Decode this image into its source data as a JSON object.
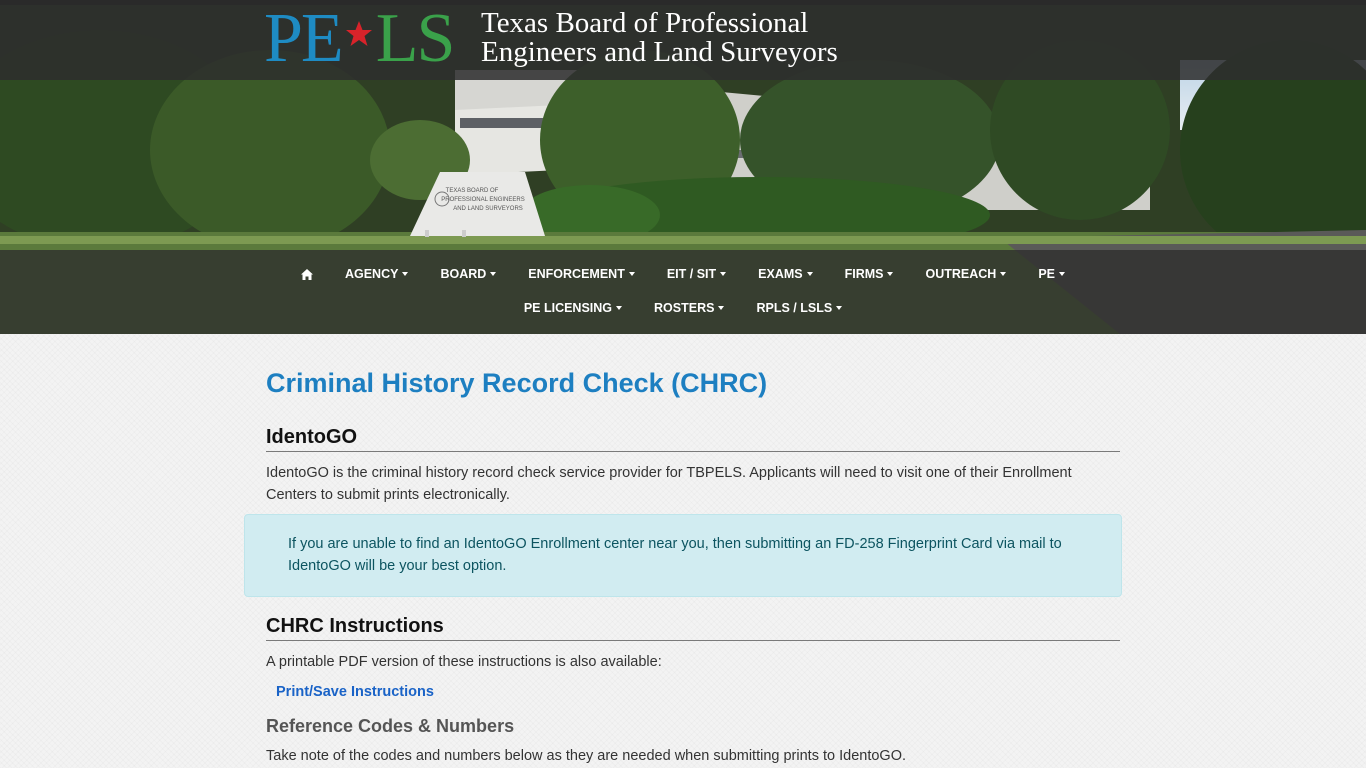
{
  "header": {
    "logo_left": "PE",
    "logo_right": "LS",
    "agency_line1": "Texas Board of Professional",
    "agency_line2": "Engineers and Land Surveyors",
    "sign_line1": "TEXAS BOARD OF",
    "sign_line2": "PROFESSIONAL ENGINEERS",
    "sign_line3": "AND LAND SURVEYORS"
  },
  "nav": {
    "row1": [
      "AGENCY",
      "BOARD",
      "ENFORCEMENT",
      "EIT / SIT",
      "EXAMS",
      "FIRMS",
      "OUTREACH",
      "PE"
    ],
    "row2": [
      "PE LICENSING",
      "ROSTERS",
      "RPLS / LSLS"
    ]
  },
  "main": {
    "title": "Criminal History Record Check (CHRC)",
    "identogo_heading": "IdentoGO",
    "identogo_text": "IdentoGO is the criminal history record check service provider for TBPELS. Applicants will need to visit one of their Enrollment Centers to submit prints electronically.",
    "alert_text": "If you are unable to find an IdentoGO Enrollment center near you, then submitting an FD-258 Fingerprint Card via mail to IdentoGO will be your best option.",
    "instructions_heading": "CHRC Instructions",
    "instructions_text": "A printable PDF version of these instructions is also available:",
    "print_link": "Print/Save Instructions",
    "ref_heading": "Reference Codes & Numbers",
    "ref_text": "Take note of the codes and numbers below as they are needed when submitting prints to IdentoGO."
  },
  "colors": {
    "title_blue": "#1d7fc1",
    "link_blue": "#1a63c7",
    "alert_bg": "#d1ecf1",
    "logo_blue": "#1e8bc3",
    "logo_green": "#3aa14a",
    "texas_red": "#d8232a"
  }
}
